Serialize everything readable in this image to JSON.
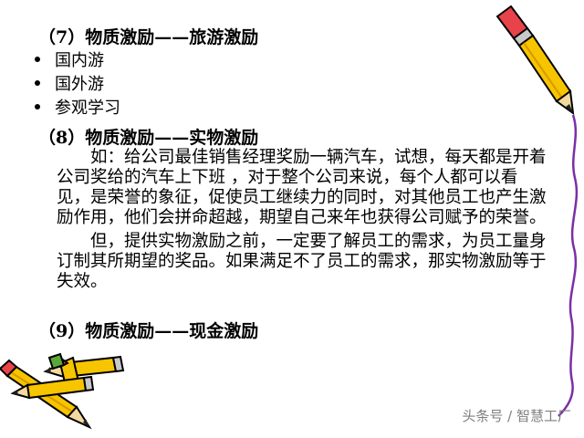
{
  "slide": {
    "section7_title": "（7）物质激励——旅游激励",
    "section7_items": [
      "国内游",
      "国外游",
      "参观学习"
    ],
    "section8_title": "（8）物质激励——实物激励",
    "section8_paragraphs": [
      "如：给公司最佳销售经理奖励一辆汽车，试想，每天都是开着公司奖给的汽车上下班 ，对于整个公司来说，每个人都可以看见，是荣誉的象征，促使员工继续力的同时，对其他员工也产生激励作用，他们会拼命超越，期望自己来年也获得公司赋予的荣誉。",
      "但，提供实物激励之前，一定要了解员工的需求，为员工量身订制其所期望的奖品。如果满足不了员工的需求，那实物激励等于失效。"
    ],
    "section9_title": "（9）物质激励——现金激励",
    "watermark": "头条号 / 智慧工厂"
  },
  "decorations": {
    "pencil_icon_top_right": "pencil-icon",
    "pencils_icon_bottom_left": "pencils-icon",
    "wavy_line": "purple-wavy-line",
    "colors": {
      "pencil_yellow": "#f7c400",
      "pencil_eraser": "#e8434a",
      "wavy_purple": "#7b2fa6"
    }
  }
}
